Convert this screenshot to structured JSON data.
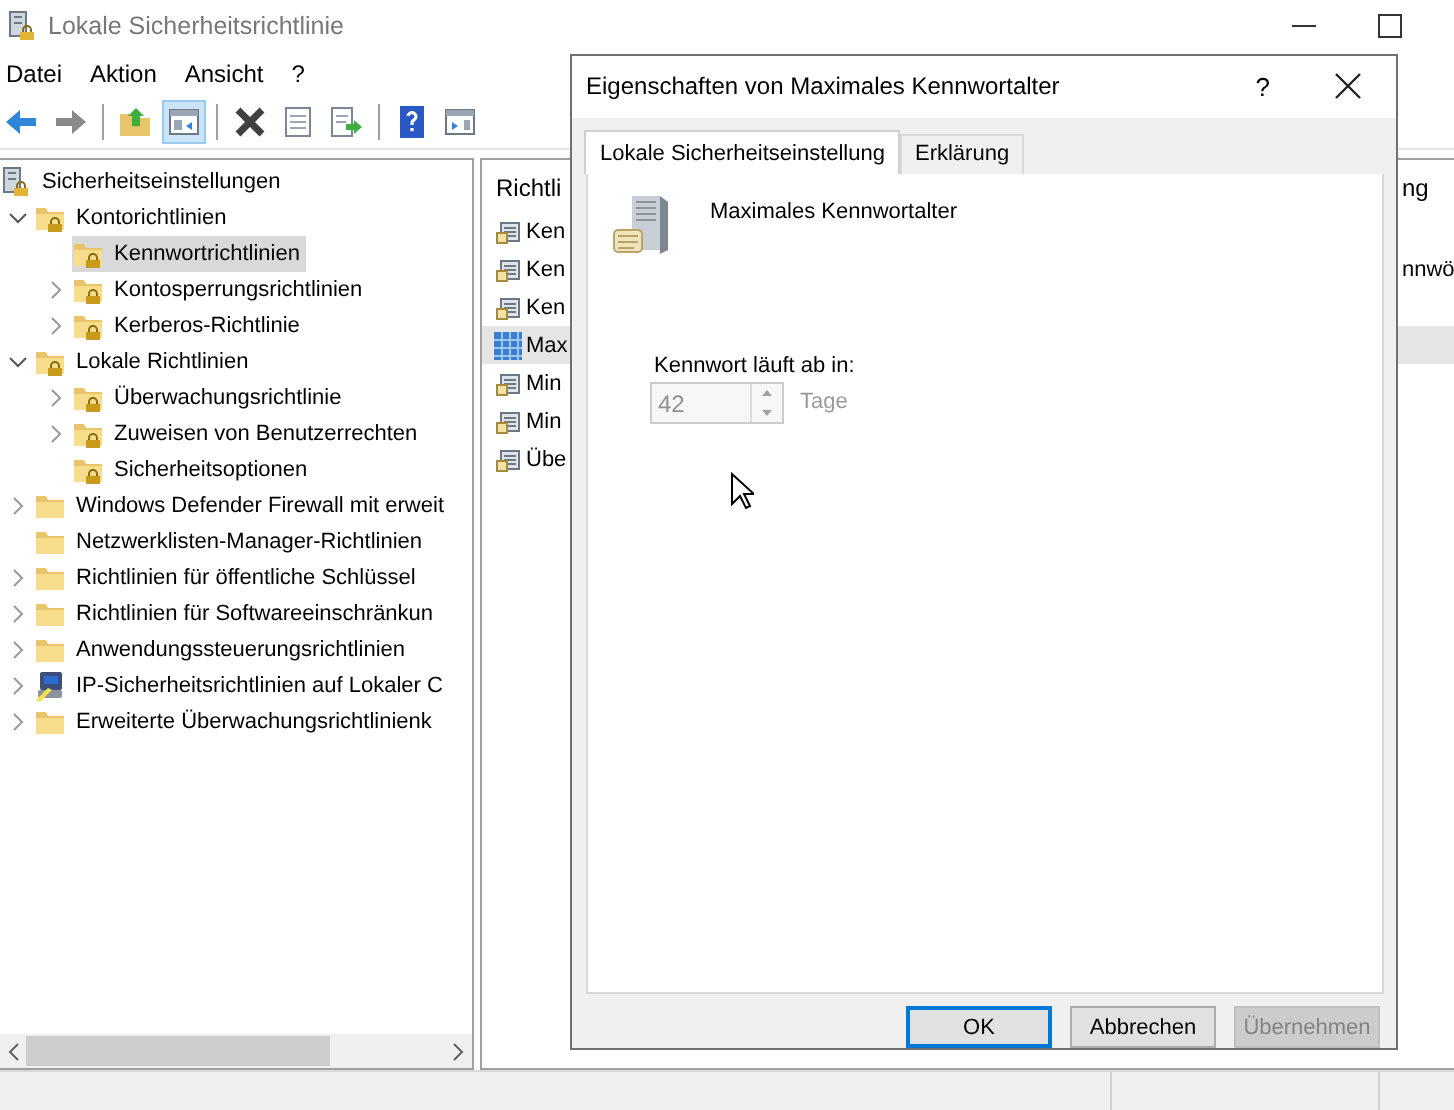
{
  "window": {
    "title": "Lokale Sicherheitsrichtlinie"
  },
  "menu": [
    "Datei",
    "Aktion",
    "Ansicht",
    "?"
  ],
  "toolbar": [
    [
      {
        "kind": "back",
        "pressed": false
      },
      {
        "kind": "forward",
        "pressed": false
      }
    ],
    [
      {
        "kind": "up",
        "pressed": false
      },
      {
        "kind": "tree",
        "pressed": true
      }
    ],
    [
      {
        "kind": "delete",
        "pressed": false
      },
      {
        "kind": "properties",
        "pressed": false
      },
      {
        "kind": "export",
        "pressed": false
      }
    ],
    [
      {
        "kind": "help",
        "pressed": false
      },
      {
        "kind": "console",
        "pressed": false
      }
    ]
  ],
  "tree": [
    {
      "label": "Sicherheitseinstellungen",
      "kind": "policy",
      "selected": false,
      "children": [
        {
          "label": "Kontorichtlinien",
          "kind": "folder-lock",
          "selected": false,
          "expanded": true,
          "children": [
            {
              "label": "Kennwortrichtlinien",
              "kind": "folder-lock",
              "selected": true
            },
            {
              "label": "Kontosperrungsrichtlinien",
              "kind": "folder-lock",
              "selected": false,
              "expanded": false
            },
            {
              "label": "Kerberos-Richtlinie",
              "kind": "folder-lock",
              "selected": false,
              "expanded": false
            }
          ]
        },
        {
          "label": "Lokale Richtlinien",
          "kind": "folder-lock",
          "selected": false,
          "expanded": true,
          "children": [
            {
              "label": "Überwachungsrichtlinie",
              "kind": "folder-lock",
              "selected": false,
              "expanded": false
            },
            {
              "label": "Zuweisen von Benutzerrechten",
              "kind": "folder-lock",
              "selected": false,
              "expanded": false
            },
            {
              "label": "Sicherheitsoptionen",
              "kind": "folder-lock",
              "selected": false
            }
          ]
        },
        {
          "label": "Windows Defender Firewall mit erweit",
          "kind": "folder",
          "selected": false,
          "expanded": false
        },
        {
          "label": "Netzwerklisten-Manager-Richtlinien",
          "kind": "folder",
          "selected": false
        },
        {
          "label": "Richtlinien für öffentliche Schlüssel",
          "kind": "folder",
          "selected": false,
          "expanded": false
        },
        {
          "label": "Richtlinien für Softwareeinschränkun",
          "kind": "folder",
          "selected": false,
          "expanded": false
        },
        {
          "label": "Anwendungssteuerungsrichtlinien",
          "kind": "folder",
          "selected": false,
          "expanded": false
        },
        {
          "label": "IP-Sicherheitsrichtlinien auf Lokaler C",
          "kind": "ip-security",
          "selected": false,
          "expanded": false
        },
        {
          "label": "Erweiterte Überwachungsrichtlinienk",
          "kind": "folder",
          "selected": false,
          "expanded": false
        }
      ]
    }
  ],
  "list": {
    "column_1": "Richtli",
    "column_2": "ng",
    "rows": [
      {
        "name": "Ken",
        "selected": false
      },
      {
        "name": "Ken",
        "column_2": "nnwö",
        "selected": false
      },
      {
        "name": "Ken",
        "selected": false
      },
      {
        "name": "Max",
        "selected": true
      },
      {
        "name": "Min",
        "selected": false
      },
      {
        "name": "Min",
        "selected": false
      },
      {
        "name": "Übe",
        "selected": false
      }
    ]
  },
  "dialog": {
    "title": "Eigenschaften von Maximales Kennwortalter",
    "help": "?",
    "tabs": [
      {
        "label": "Lokale Sicherheitseinstellung",
        "selected": true
      },
      {
        "label": "Erklärung",
        "selected": false
      }
    ],
    "policy_name": "Maximales Kennwortalter",
    "field_label": "Kennwort läuft ab in:",
    "spin": {
      "value": "42",
      "unit": "Tage",
      "disabled": true
    },
    "buttons": [
      {
        "label": "OK",
        "default": true,
        "disabled": false
      },
      {
        "label": "Abbrechen",
        "default": false,
        "disabled": false
      },
      {
        "label": "Übernehmen",
        "default": false,
        "disabled": true
      }
    ]
  }
}
